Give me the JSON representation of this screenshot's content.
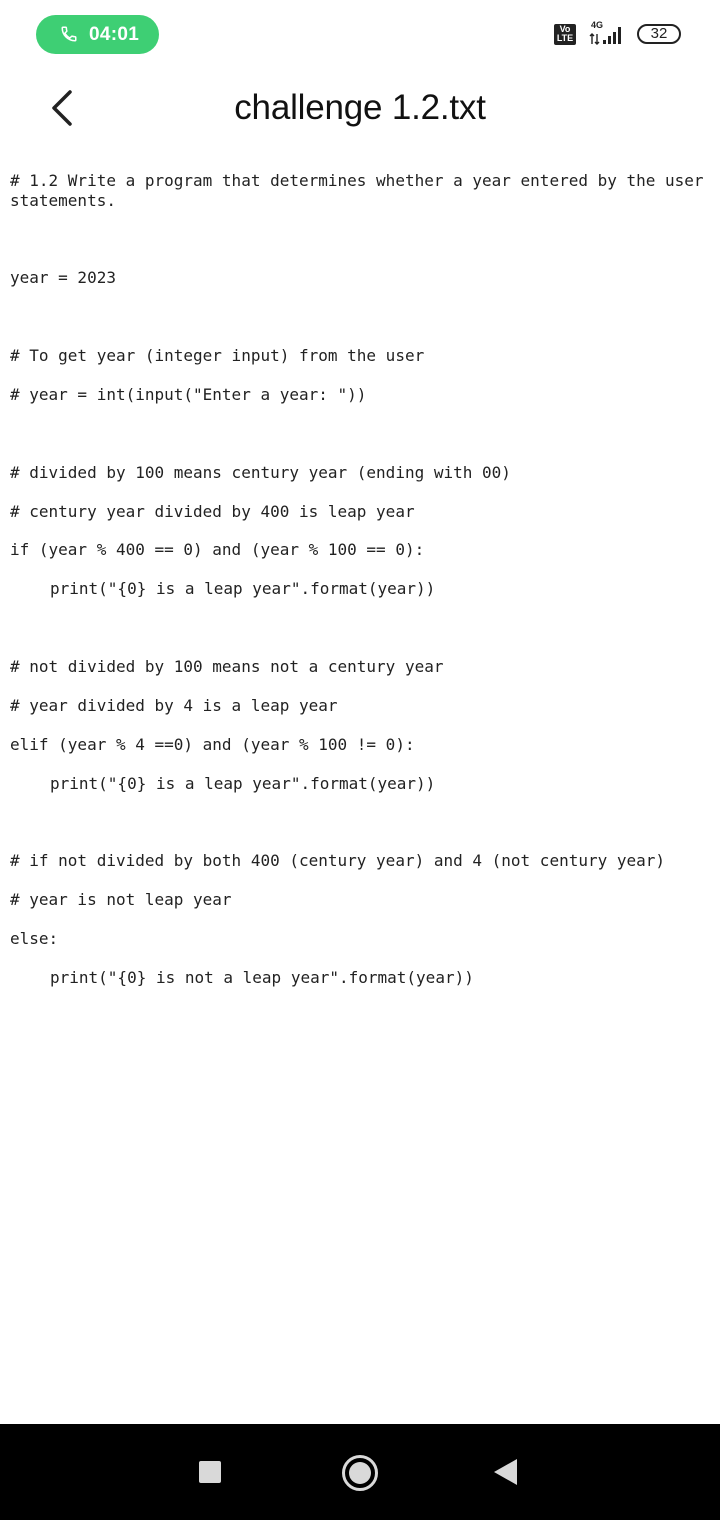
{
  "status_bar": {
    "call_time": "04:01",
    "volte_line1": "Vo",
    "volte_line2": "LTE",
    "network": "4G",
    "battery": "32",
    "call_color": "#3ecf74"
  },
  "header": {
    "title": "challenge 1.2.txt",
    "back_icon": "chevron-left-icon"
  },
  "code": {
    "lines": [
      "# 1.2 Write a program that determines whether a year entered by the user",
      "statements.",
      "year = 2023",
      "# To get year (integer input) from the user",
      "# year = int(input(\"Enter a year: \"))",
      "# divided by 100 means century year (ending with 00)",
      "# century year divided by 400 is leap year",
      "if (year % 400 == 0) and (year % 100 == 0):",
      "print(\"{0} is a leap year\".format(year))",
      "# not divided by 100 means not a century year",
      "# year divided by 4 is a leap year",
      "elif (year % 4 ==0) and (year % 100 != 0):",
      "print(\"{0} is a leap year\".format(year))",
      "# if not divided by both 400 (century year) and 4 (not century year)",
      "# year is not leap year",
      "else:",
      "print(\"{0} is not a leap year\".format(year))"
    ]
  },
  "nav_bar": {
    "recents_icon": "square-icon",
    "home_icon": "circle-icon",
    "back_icon": "triangle-back-icon"
  }
}
